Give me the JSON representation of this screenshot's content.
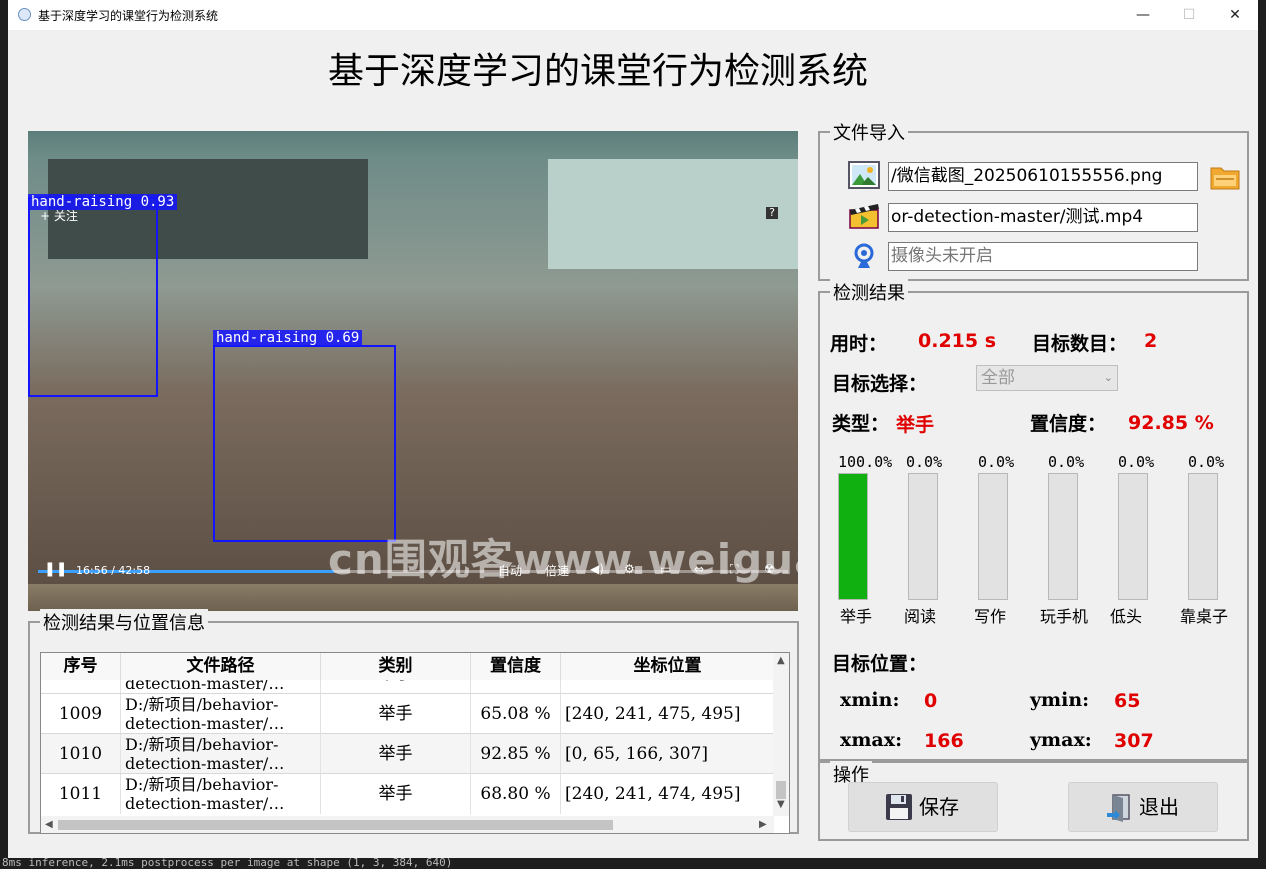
{
  "window": {
    "title": "基于深度学习的课堂行为检测系统",
    "controls": {
      "minimize": "—",
      "maximize": "☐",
      "close": "✕"
    }
  },
  "main_title": "基于深度学习的课堂行为检测系统",
  "video": {
    "follow_label": "+ 关注",
    "detections": [
      {
        "label": "hand-raising 0.93"
      },
      {
        "label": "hand-raising 0.69"
      }
    ],
    "time": "16:56 / 42:58",
    "progress": 0.394,
    "controls": {
      "auto": "自动",
      "speed": "倍速"
    },
    "help": "?",
    "watermark": "cn围观客www.weiguanke.cn"
  },
  "file_import": {
    "title": "文件导入",
    "image_path": "/微信截图_20250610155556.png",
    "video_path": "or-detection-master/测试.mp4",
    "camera_placeholder": "摄像头未开启",
    "icons": [
      "image-icon",
      "video-icon",
      "camera-icon",
      "folder-icon"
    ]
  },
  "results": {
    "title": "检测结果",
    "time_label": "用时：",
    "time_value": "0.215 s",
    "count_label": "目标数目：",
    "count_value": "2",
    "select_label": "目标选择：",
    "select_value": "全部",
    "type_label": "类型：",
    "type_value": "举手",
    "conf_label": "置信度：",
    "conf_value": "92.85 %",
    "bars": [
      {
        "name": "举手",
        "pct_label": "100.0%",
        "value": 1.0
      },
      {
        "name": "阅读",
        "pct_label": "0.0%",
        "value": 0.0
      },
      {
        "name": "写作",
        "pct_label": "0.0%",
        "value": 0.0
      },
      {
        "name": "玩手机",
        "pct_label": "0.0%",
        "value": 0.0
      },
      {
        "name": "低头",
        "pct_label": "0.0%",
        "value": 0.0
      },
      {
        "name": "靠桌子",
        "pct_label": "0.0%",
        "value": 0.0
      }
    ],
    "bar_color": "#10b010",
    "position_label": "目标位置：",
    "xmin_label": "xmin:",
    "xmin": "0",
    "ymin_label": "ymin:",
    "ymin": "65",
    "xmax_label": "xmax:",
    "xmax": "166",
    "ymax_label": "ymax:",
    "ymax": "307"
  },
  "operations": {
    "title": "操作",
    "save_label": "保存",
    "exit_label": "退出"
  },
  "table": {
    "title": "检测结果与位置信息",
    "headers": [
      "序号",
      "文件路径",
      "类别",
      "置信度",
      "坐标位置"
    ],
    "partial_row": {
      "path": "detection-master/…",
      "class": "举手"
    },
    "rows": [
      {
        "id": "1009",
        "path_1": "D:/新项目/behavior-",
        "path_2": "detection-master/…",
        "class": "举手",
        "conf": "65.08 %",
        "coords": "[240, 241, 475, 495]"
      },
      {
        "id": "1010",
        "path_1": "D:/新项目/behavior-",
        "path_2": "detection-master/…",
        "class": "举手",
        "conf": "92.85 %",
        "coords": "[0, 65, 166, 307]"
      },
      {
        "id": "1011",
        "path_1": "D:/新项目/behavior-",
        "path_2": "detection-master/…",
        "class": "举手",
        "conf": "68.80 %",
        "coords": "[240, 241, 474, 495]"
      }
    ]
  },
  "terminal_text": "8ms inference, 2.1ms postprocess per image at shape (1, 3, 384, 640)"
}
